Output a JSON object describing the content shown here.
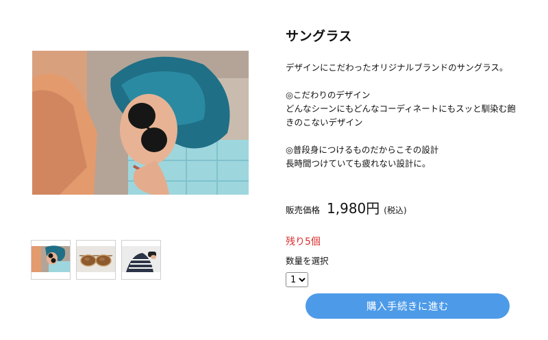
{
  "product": {
    "title": "サングラス",
    "description": [
      "デザインにこだわったオリジナルブランドのサングラス。",
      "",
      "◎こだわりのデザイン",
      "どんなシーンにもどんなコーディネートにもスッと馴染む飽",
      "きのこないデザイン",
      "",
      "◎普段身につけるものだからこその設計",
      "長時間つけていても疲れない設計に。"
    ],
    "price_label": "販売価格",
    "price_value": "1,980円",
    "price_tax": "(税込)",
    "stock_text": "残り5個",
    "quantity_label": "数量を選択",
    "quantity_selected": "1",
    "buy_button_label": "購入手続きに進む"
  },
  "gallery": {
    "main_image": "woman-with-blue-hair-wearing-sunglasses-photo",
    "thumbnails": [
      {
        "image": "woman-with-blue-hair-wearing-sunglasses-photo"
      },
      {
        "image": "aviator-sunglasses-photo"
      },
      {
        "image": "person-in-striped-shirt-holding-sunglasses-photo"
      }
    ]
  },
  "colors": {
    "button": "#4d9be8",
    "stock": "#d92b2b",
    "hair": "#1f6f86",
    "pool_water": "#8fd5e0"
  }
}
